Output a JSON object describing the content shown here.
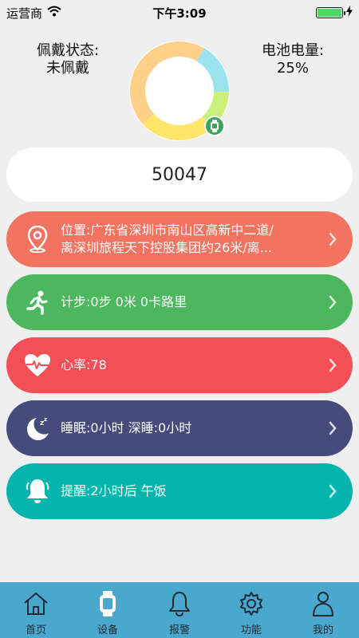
{
  "status_bar": {
    "carrier": "运营商",
    "time": "下午3:09",
    "battery_level": 1.0
  },
  "device": {
    "wear_label": "佩戴状态:",
    "wear_value": "未佩戴",
    "battery_label": "电池电量:",
    "battery_value": "25%",
    "donut_segments": [
      {
        "color": "#fed089",
        "fraction": 0.45
      },
      {
        "color": "#fde66a",
        "fraction": 0.25
      },
      {
        "color": "#c9f07a",
        "fraction": 0.13
      },
      {
        "color": "#9be3ef",
        "fraction": 0.17
      }
    ]
  },
  "number_card": {
    "value": "50047"
  },
  "rows": [
    {
      "key": "location",
      "line1": "位置:广东省深圳市南山区高新中二道/",
      "line2": "离深圳旅程天下控股集团约26米/离...",
      "color": "#f27360",
      "icon": "location-pin-icon"
    },
    {
      "key": "steps",
      "text": "计步:0步 0米 0卡路里",
      "color": "#4cb75c",
      "icon": "runner-icon"
    },
    {
      "key": "heart",
      "text": "心率:78",
      "color": "#f25056",
      "icon": "heart-rate-icon"
    },
    {
      "key": "sleep",
      "text": "睡眠:0小时 深睡:0小时",
      "color": "#454b7b",
      "icon": "moon-sleep-icon"
    },
    {
      "key": "reminder",
      "text": "提醒:2小时后 午饭",
      "color": "#04b5ad",
      "icon": "bell-icon"
    }
  ],
  "tabs": [
    {
      "label": "首页",
      "icon": "home-icon"
    },
    {
      "label": "设备",
      "icon": "watch-icon"
    },
    {
      "label": "报警",
      "icon": "bell-icon"
    },
    {
      "label": "功能",
      "icon": "gear-icon"
    },
    {
      "label": "我的",
      "icon": "person-icon"
    }
  ],
  "colors": {
    "background": "#efefef",
    "tabbar": "#4aa8cf",
    "tab_label": "#1f2a33"
  }
}
